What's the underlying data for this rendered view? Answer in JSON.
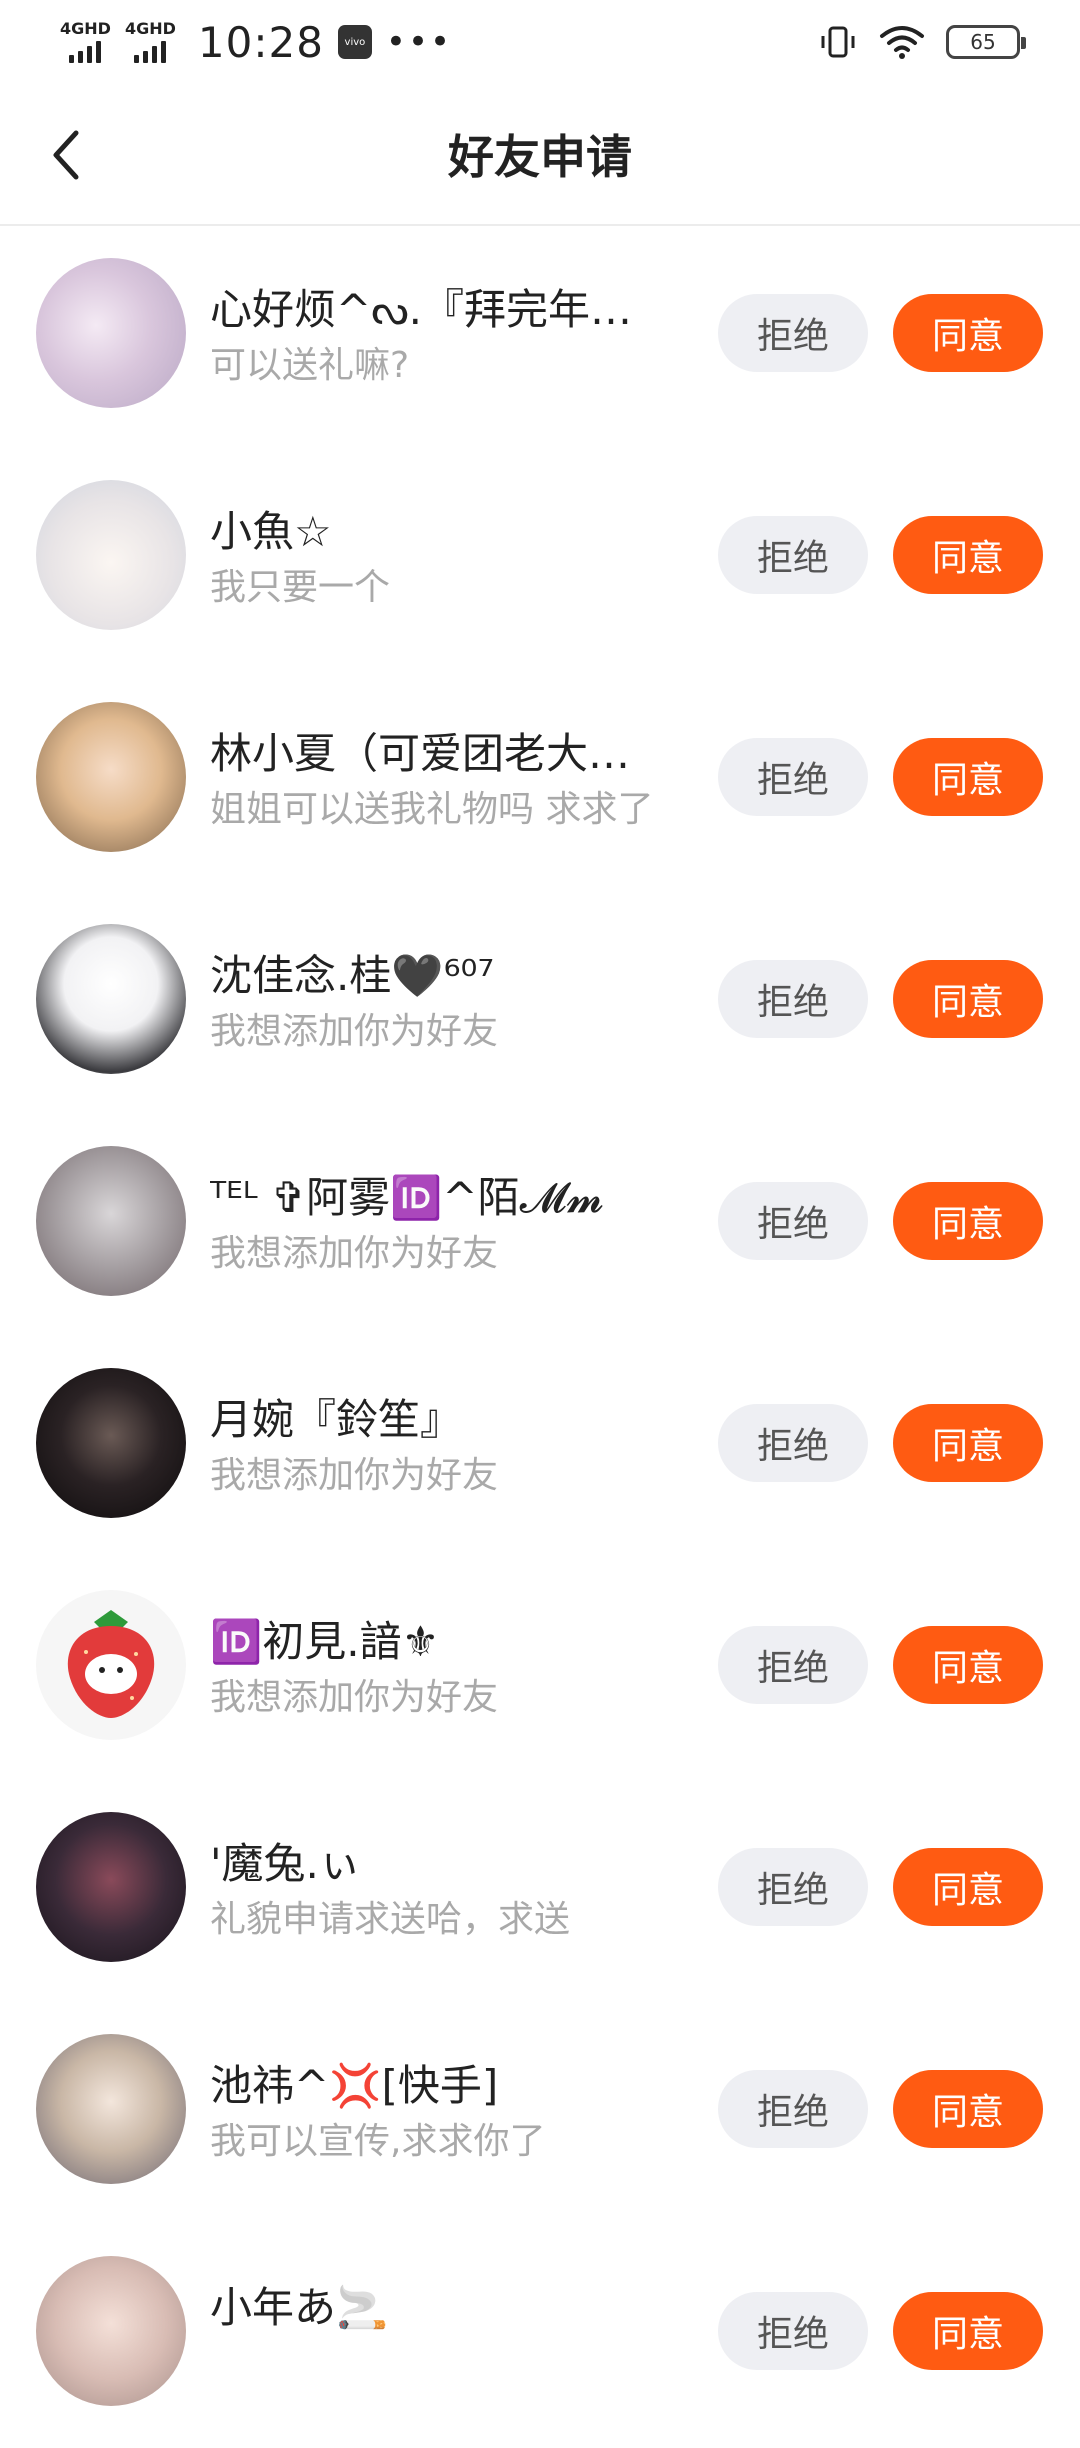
{
  "status_bar": {
    "signal1": "4GHD",
    "signal2": "4GHD",
    "time": "10:28",
    "app_badge": "vivo",
    "more": "•••",
    "battery": "65"
  },
  "header": {
    "title": "好友申请"
  },
  "buttons": {
    "reject": "拒绝",
    "accept": "同意"
  },
  "requests": [
    {
      "name": "心好烦^ᔓ.『拜完年…",
      "message": "可以送礼嘛?"
    },
    {
      "name": "小魚☆",
      "message": "我只要一个"
    },
    {
      "name": "林小夏（可爱团老大…",
      "message": "姐姐可以送我礼物吗 求求了"
    },
    {
      "name": "沈佳念.桂🖤⁶⁰⁷",
      "message": "我想添加你为好友"
    },
    {
      "name": "ᵀᴱᴸ ✞阿雾🆔^陌𝓜𝓶",
      "message": "我想添加你为好友"
    },
    {
      "name": "月婉『鈴笙』",
      "message": "我想添加你为好友"
    },
    {
      "name": "🆔初見.諳⚜",
      "message": "我想添加你为好友"
    },
    {
      "name": "'魔兔.ぃ",
      "message": "礼貌申请求送哈，求送"
    },
    {
      "name": "池祎^💢[快手]",
      "message": "我可以宣传,求求你了"
    },
    {
      "name": "小年あ🚬",
      "message": ""
    }
  ],
  "colors": {
    "accept_bg": "#ff5b12",
    "reject_bg": "#eeeff3",
    "message_text": "#a9a9a9"
  }
}
